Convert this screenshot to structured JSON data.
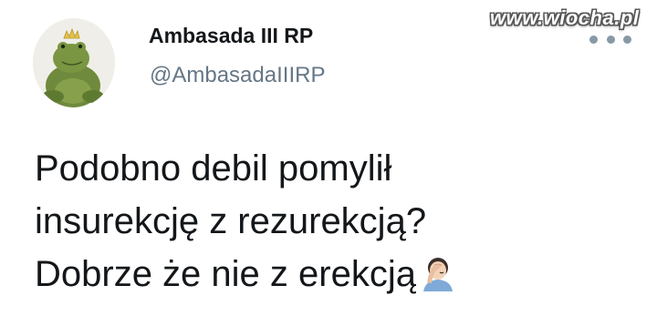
{
  "watermark": "www.wiocha.pl",
  "tweet": {
    "display_name": "Ambasada III RP",
    "handle": "@AmbasadaIIIRP",
    "text_lines": [
      "Podobno debil pomylił",
      "insurekcję z rezurekcją?",
      "Dobrze że nie z erekcją"
    ],
    "emoji": "facepalm-icon",
    "avatar": "frog-prince-plush-avatar"
  },
  "colors": {
    "text": "#14171a",
    "secondary": "#657786",
    "menu_dots": "#8899a6"
  }
}
